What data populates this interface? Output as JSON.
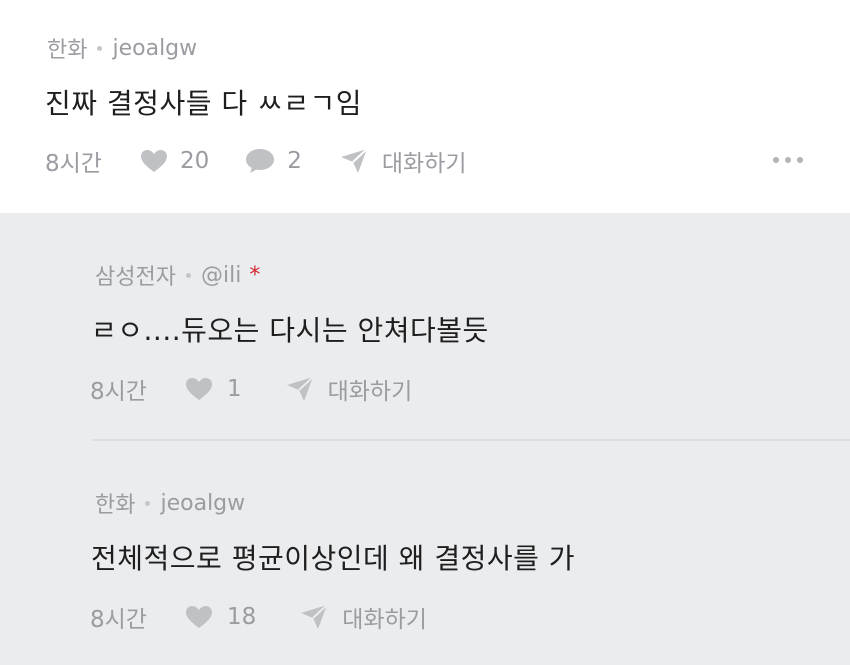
{
  "comment": {
    "company": "한화",
    "user": "jeoalgw",
    "text": "진짜 결정사들 다 ㅆㄹㄱ임",
    "time": "8시간",
    "likes": "20",
    "comments": "2",
    "chat_label": "대화하기"
  },
  "replies": [
    {
      "company": "삼성전자",
      "user": "@ili",
      "badge": "*",
      "text": "ㄹㅇ....듀오는 다시는 안쳐다볼듯",
      "time": "8시간",
      "likes": "1",
      "chat_label": "대화하기"
    },
    {
      "company": "한화",
      "user": "jeoalgw",
      "text": "전체적으로 평균이상인데 왜 결정사를 가",
      "time": "8시간",
      "likes": "18",
      "chat_label": "대화하기"
    }
  ],
  "icons": {
    "like": "heart-icon",
    "comment": "speech-bubble-icon",
    "chat": "paper-plane-icon",
    "more": "more-dots-icon"
  },
  "colors": {
    "muted": "#9a9ca1",
    "icon": "#bfc1c5",
    "badge": "#d2282e",
    "reply_bg": "#ebecee"
  }
}
